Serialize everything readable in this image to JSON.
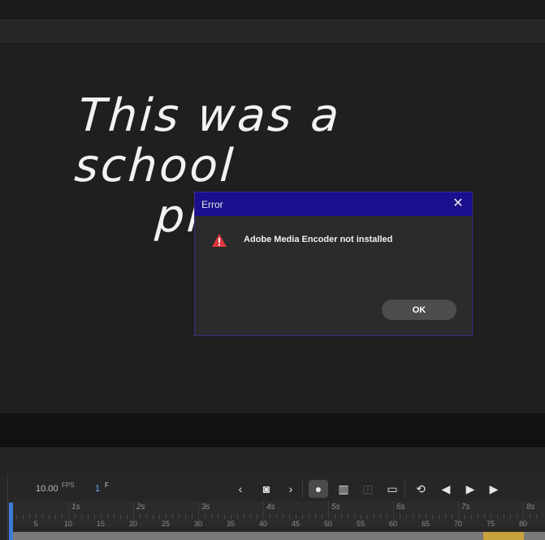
{
  "stage": {
    "handwriting_line1": "This was a school",
    "handwriting_line2": "project..."
  },
  "dialog": {
    "title": "Error",
    "close_glyph": "✕",
    "icon": "warning-icon",
    "message": "Adobe Media Encoder not installed",
    "ok_label": "OK"
  },
  "timeline": {
    "fps_value": "10.00",
    "fps_unit": "FPS",
    "frame_value": "1",
    "frame_unit": "F",
    "controls": [
      {
        "name": "prev-keyframe-icon",
        "glyph": "‹"
      },
      {
        "name": "add-keyframe-icon",
        "glyph": "◙"
      },
      {
        "name": "next-keyframe-icon",
        "glyph": "›"
      },
      {
        "name": "onion-skin-icon",
        "glyph": "●"
      },
      {
        "name": "edit-multiple-frames-icon",
        "glyph": "▥"
      },
      {
        "name": "disabled-frames-icon",
        "glyph": "◫"
      },
      {
        "name": "center-frame-icon",
        "glyph": "▭"
      },
      {
        "name": "loop-icon",
        "glyph": "⟲"
      },
      {
        "name": "step-back-icon",
        "glyph": "◀"
      },
      {
        "name": "play-icon",
        "glyph": "▶"
      },
      {
        "name": "step-forward-icon",
        "glyph": "▶"
      }
    ],
    "seconds": [
      "1s",
      "2s",
      "3s",
      "4s",
      "5s",
      "6s",
      "7s",
      "8s"
    ],
    "frame_numbers": [
      "5",
      "10",
      "15",
      "20",
      "25",
      "30",
      "35",
      "40",
      "45",
      "50",
      "55",
      "60",
      "65",
      "70",
      "75",
      "80"
    ]
  },
  "colors": {
    "dialog_title_bar": "#1a0f8c",
    "warning": "#e0383e",
    "playhead": "#3d7ad9"
  }
}
